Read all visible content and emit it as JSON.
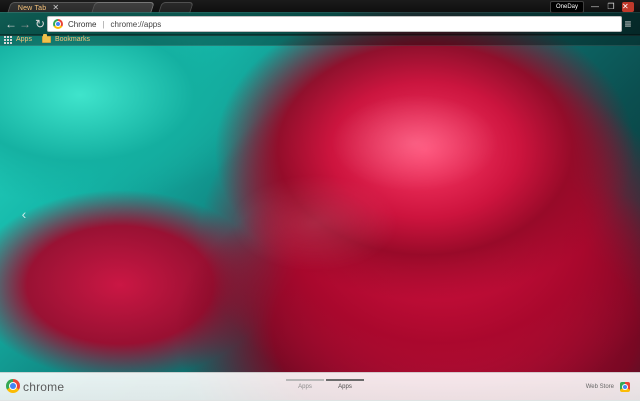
{
  "browser": {
    "tabs": [
      {
        "label": "New Tab",
        "active": true
      },
      {
        "label": "",
        "active": false
      }
    ],
    "profile_label": "OneDay",
    "window_controls": {
      "minimize": "—",
      "maximize": "❐",
      "close": "✕"
    },
    "toolbar": {
      "back": "←",
      "forward": "→",
      "reload": "↻",
      "menu": "≡"
    },
    "omnibox": {
      "site_label": "Chrome",
      "separator": "|",
      "url": "chrome://apps"
    },
    "bookmarks": [
      {
        "label": "Apps",
        "icon": "apps-grid-icon"
      },
      {
        "label": "Bookmarks",
        "icon": "folder-icon"
      }
    ]
  },
  "overlay": {
    "left_arrow": "‹"
  },
  "bottom_bar": {
    "brand": "chrome",
    "page_tabs": [
      {
        "label": "Apps",
        "active": false
      },
      {
        "label": "Apps",
        "active": true
      }
    ],
    "webstore_label": "Web Store"
  }
}
